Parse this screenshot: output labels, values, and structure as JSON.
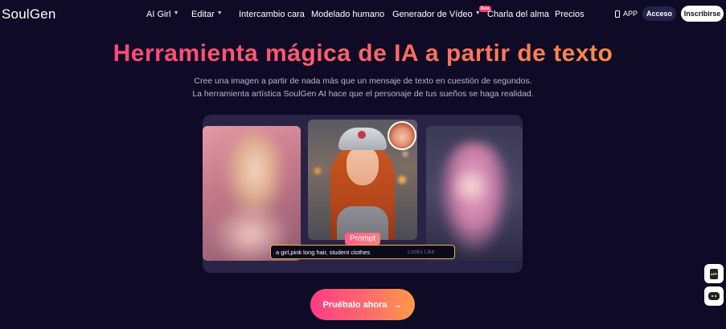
{
  "nav": {
    "logo": "SoulGen",
    "items": [
      {
        "label": "AI Girl",
        "has_caret": true
      },
      {
        "label": "Editar",
        "has_caret": true
      },
      {
        "label": "Intercambio cara",
        "has_caret": false
      },
      {
        "label": "Modelado humano",
        "has_caret": false
      },
      {
        "label": "Generador de Vídeo",
        "has_caret": true,
        "badge": "Beta"
      },
      {
        "label": "Charla del alma",
        "has_caret": false
      },
      {
        "label": "Precios",
        "has_caret": false
      }
    ],
    "app_label": "APP",
    "login_label": "Acceso",
    "signup_label": "Inscribirse"
  },
  "hero": {
    "title": "Herramienta mágica de IA a partir de texto",
    "subtitle_line1": "Cree una imagen a partir de nada más que un mensaje de texto en cuestión de segundos.",
    "subtitle_line2": "La herramienta artística SoulGen AI hace que el personaje de tus sueños se haga realidad."
  },
  "showcase": {
    "prompt_tag": "Prompt",
    "prompt_text": "a girl,pink long hair, student clothes",
    "prompt_ghost": "Looks Like"
  },
  "cta": {
    "label": "Pruébalo ahora",
    "arrow_icon": "arrow-right-icon"
  },
  "floating": {
    "app_icon_text": "APP",
    "discord_icon": "discord-icon"
  },
  "colors": {
    "background": "#0f0a26",
    "title_gradient_start": "#ff3d7f",
    "title_gradient_end": "#ff9a3c",
    "prompt_border": "#e6b84a"
  }
}
